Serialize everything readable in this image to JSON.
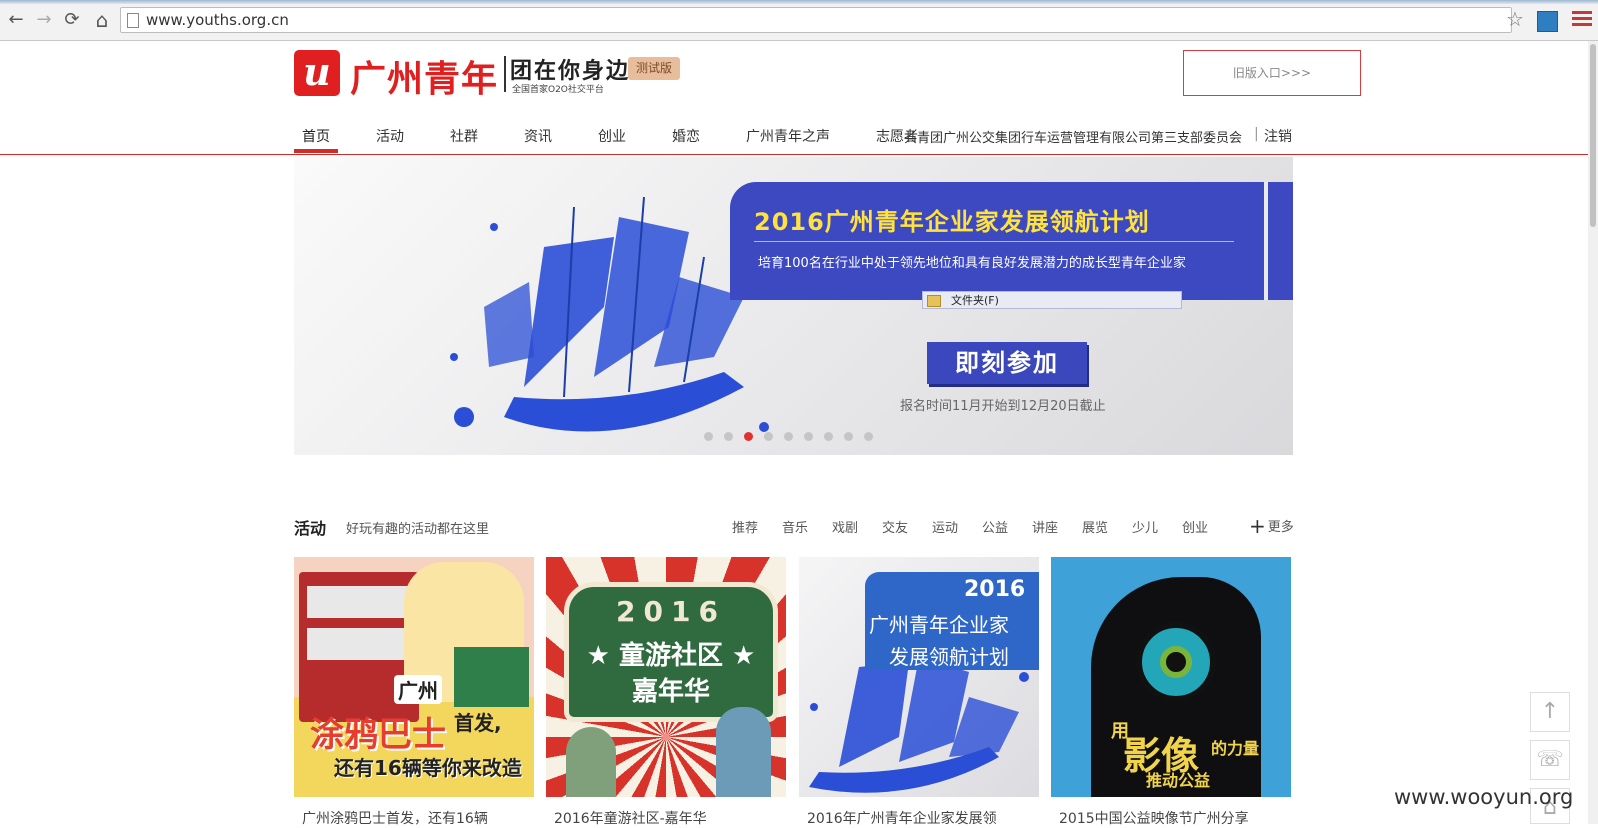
{
  "browser": {
    "back_glyph": "←",
    "forward_glyph": "→",
    "reload_glyph": "⟳",
    "home_glyph": "⌂",
    "url": "www.youths.org.cn",
    "star_glyph": "☆"
  },
  "header": {
    "logo_mark": "u",
    "logo_text": "广州青年",
    "slogan": "团在你身边",
    "subslogan": "全国首家O2O社交平台",
    "badge": "测试版",
    "old_entry": "旧版入口>>>"
  },
  "nav": {
    "items": [
      "首页",
      "活动",
      "社群",
      "资讯",
      "创业",
      "婚恋",
      "广州青年之声",
      "志愿者"
    ],
    "user": "共青团广州公交集团行车运营管理有限公司第三支部委员会",
    "separator": "|",
    "logout": "注销"
  },
  "banner": {
    "title": "2016广州青年企业家发展领航计划",
    "subtitle": "培育100名在行业中处于领先地位和具有良好发展潜力的成长型青年企业家",
    "tooltip": "文件夹(F)",
    "cta": "即刻参加",
    "reg_time": "报名时间11月开始到12月20日截止",
    "slide_count": 9,
    "active_slide": 2
  },
  "activity": {
    "title": "活动",
    "subtitle": "好玩有趣的活动都在这里",
    "categories": [
      "推荐",
      "音乐",
      "戏剧",
      "交友",
      "运动",
      "公益",
      "讲座",
      "展览",
      "少儿",
      "创业"
    ],
    "more_icon": "+",
    "more": "更多",
    "cards": [
      {
        "caption": "广州涂鸦巴士首发，还有16辆",
        "img_t1": "广州",
        "img_t2": "涂鸦巴士",
        "img_t3": "首发,",
        "img_t4": "还有16辆等你来改造"
      },
      {
        "caption": "2016年童游社区-嘉年华",
        "img_year": "2016",
        "img_n1": "★ 童游社区 ★",
        "img_n2": "嘉年华"
      },
      {
        "caption": "2016年广州青年企业家发展领",
        "img_year": "2016",
        "img_l1": "广州青年企业家",
        "img_l2": "发展领航计划"
      },
      {
        "caption": "2015中国公益映像节广州分享",
        "img_w1": "用",
        "img_w2": "影像",
        "img_w3": "的力量",
        "img_w4": "推动公益"
      }
    ]
  },
  "float_tools": {
    "top_icon": "↑",
    "service_icon": "☏",
    "home_icon": "⌂"
  },
  "watermark": "www.wooyun.org",
  "colors": {
    "brand_red": "#e02020",
    "banner_blue": "#3c49c1",
    "banner_title": "#ffe33c"
  }
}
